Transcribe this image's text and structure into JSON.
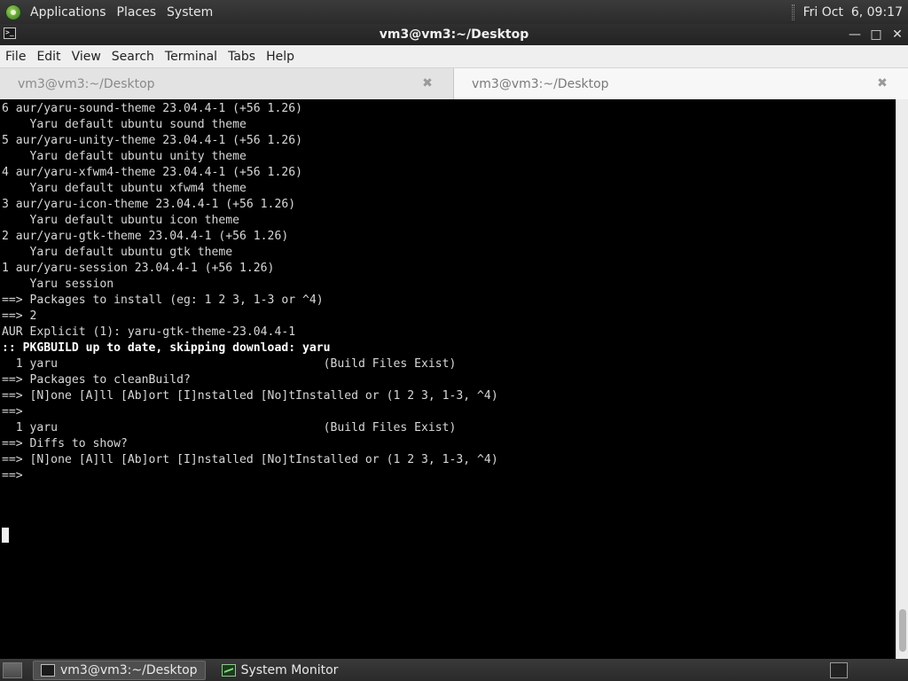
{
  "top_panel": {
    "menus": [
      "Applications",
      "Places",
      "System"
    ],
    "clock": "Fri Oct  6, 09:17"
  },
  "window": {
    "title": "vm3@vm3:~/Desktop"
  },
  "menubar": [
    "File",
    "Edit",
    "View",
    "Search",
    "Terminal",
    "Tabs",
    "Help"
  ],
  "tabs": [
    {
      "label": "vm3@vm3:~/Desktop",
      "active": false
    },
    {
      "label": "vm3@vm3:~/Desktop",
      "active": true
    }
  ],
  "terminal": {
    "lines": [
      {
        "text": "6 aur/yaru-sound-theme 23.04.4-1 (+56 1.26)",
        "bold": false
      },
      {
        "text": "    Yaru default ubuntu sound theme",
        "bold": false
      },
      {
        "text": "5 aur/yaru-unity-theme 23.04.4-1 (+56 1.26)",
        "bold": false
      },
      {
        "text": "    Yaru default ubuntu unity theme",
        "bold": false
      },
      {
        "text": "4 aur/yaru-xfwm4-theme 23.04.4-1 (+56 1.26)",
        "bold": false
      },
      {
        "text": "    Yaru default ubuntu xfwm4 theme",
        "bold": false
      },
      {
        "text": "3 aur/yaru-icon-theme 23.04.4-1 (+56 1.26)",
        "bold": false
      },
      {
        "text": "    Yaru default ubuntu icon theme",
        "bold": false
      },
      {
        "text": "2 aur/yaru-gtk-theme 23.04.4-1 (+56 1.26)",
        "bold": false
      },
      {
        "text": "    Yaru default ubuntu gtk theme",
        "bold": false
      },
      {
        "text": "1 aur/yaru-session 23.04.4-1 (+56 1.26)",
        "bold": false
      },
      {
        "text": "    Yaru session",
        "bold": false
      },
      {
        "text": "==> Packages to install (eg: 1 2 3, 1-3 or ^4)",
        "bold": false
      },
      {
        "text": "==> 2",
        "bold": false
      },
      {
        "text": "AUR Explicit (1): yaru-gtk-theme-23.04.4-1",
        "bold": false
      },
      {
        "text": ":: PKGBUILD up to date, skipping download: yaru",
        "bold": true
      },
      {
        "text": "  1 yaru                                      (Build Files Exist)",
        "bold": false
      },
      {
        "text": "==> Packages to cleanBuild?",
        "bold": false
      },
      {
        "text": "==> [N]one [A]ll [Ab]ort [I]nstalled [No]tInstalled or (1 2 3, 1-3, ^4)",
        "bold": false
      },
      {
        "text": "==>",
        "bold": false
      },
      {
        "text": "  1 yaru                                      (Build Files Exist)",
        "bold": false
      },
      {
        "text": "==> Diffs to show?",
        "bold": false
      },
      {
        "text": "==> [N]one [A]ll [Ab]ort [I]nstalled [No]tInstalled or (1 2 3, 1-3, ^4)",
        "bold": false
      },
      {
        "text": "==>",
        "bold": false
      }
    ]
  },
  "taskbar": {
    "tasks": [
      {
        "label": "vm3@vm3:~/Desktop",
        "icon": "terminal-icon",
        "active": true
      },
      {
        "label": "System Monitor",
        "icon": "system-monitor-icon",
        "active": false
      }
    ]
  },
  "icons": {
    "logo": "distro-logo-icon",
    "close": "close-icon",
    "minimize": "minimize-icon",
    "maximize": "maximize-icon"
  }
}
